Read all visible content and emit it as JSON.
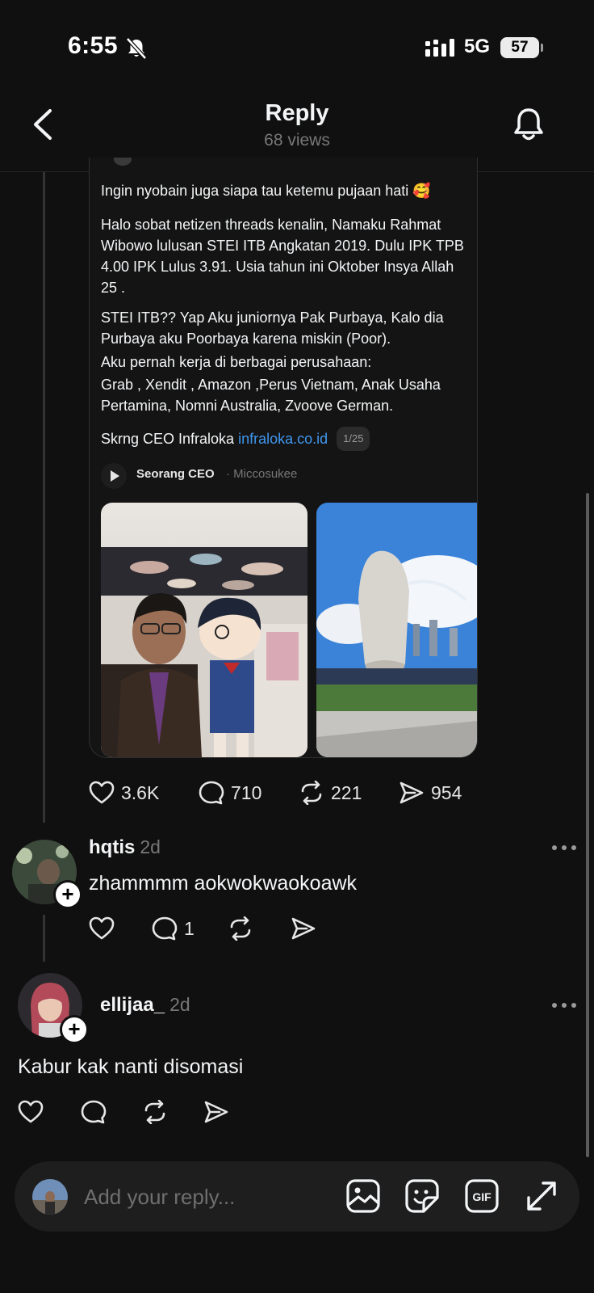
{
  "status_bar": {
    "time": "6:55",
    "network": "5G",
    "battery": "57"
  },
  "header": {
    "title": "Reply",
    "views": "68 views"
  },
  "quoted_post": {
    "paragraphs": [
      "Ingin nyobain juga siapa tau ketemu pujaan hati 🥰",
      "Halo sobat netizen threads kenalin, Namaku Rahmat Wibowo lulusan STEI ITB Angkatan 2019. Dulu IPK TPB 4.00 IPK Lulus 3.91. Usia tahun ini Oktober Insya Allah 25 .",
      "STEI ITB?? Yap Aku juniornya Pak Purbaya, Kalo dia Purbaya aku Poorbaya karena miskin (Poor).",
      "Aku pernah kerja di berbagai perusahaan:",
      "Grab , Xendit , Amazon ,Perus Vietnam, Anak Usaha Pertamina, Nomni Australia, Zvoove German."
    ],
    "ceo_line": "Skrng CEO Infraloka",
    "link_text": "infraloka.co.id",
    "pager": "1/25",
    "feed_name": "Seorang CEO",
    "feed_sub": "· Miccosukee"
  },
  "post_actions": {
    "likes": "3.6K",
    "comments": "710",
    "reposts": "221",
    "shares": "954"
  },
  "comments": [
    {
      "username": "hqtis",
      "age": "2d",
      "text": "zhammmm aokwokwaokoawk",
      "comment_count": "1"
    },
    {
      "username": "ellijaa_",
      "age": "2d",
      "text": "Kabur kak nanti disomasi"
    }
  ],
  "composer": {
    "placeholder": "Add your reply...",
    "gif_label": "GIF"
  }
}
